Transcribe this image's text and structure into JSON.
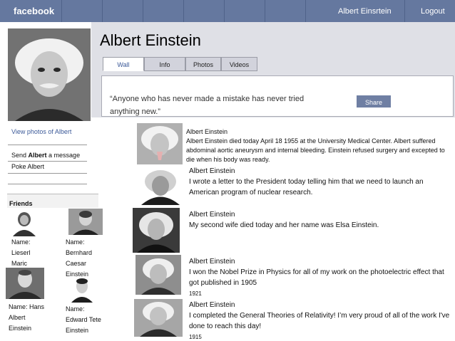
{
  "topbar": {
    "brand": "facebook",
    "user_name": "Albert Einsrtein",
    "logout": "Logout"
  },
  "profile": {
    "name": "Albert Einstein"
  },
  "tabs": [
    {
      "label": "Wall",
      "active": true
    },
    {
      "label": "Info",
      "active": false
    },
    {
      "label": "Photos",
      "active": false
    },
    {
      "label": "Videos",
      "active": false
    }
  ],
  "post": {
    "text": "“Anyone who has never made a mistake has never  tried anything new.”",
    "share_label": "Share"
  },
  "sidebar": {
    "view_photos": "View photos of Albert",
    "send_prefix": "Send ",
    "send_name": "Albert",
    "send_suffix": " a message",
    "poke": "Poke Albert",
    "friends_heading": "Friends"
  },
  "friends": [
    {
      "lines": [
        "Name:",
        "Lieserl",
        "Maric"
      ]
    },
    {
      "lines": [
        "Name:",
        "Bernhard",
        "Caesar",
        "Einstein"
      ]
    },
    {
      "lines": [
        "Name: Hans",
        "Albert",
        "Einstein"
      ]
    },
    {
      "lines": [
        "Name:",
        "Edward Tete",
        "Einstein"
      ]
    }
  ],
  "feed": [
    {
      "author": "Albert Einstein",
      "text": "Albert Einstein died today April 18 1955 at the University Medical Center. Albert suffered abdominal aortic aneurysm and internal bleeding. Einstein refused surgery and excepted to die when his body was ready.",
      "year": ""
    },
    {
      "author": "Albert Einstein",
      "text": "I wrote a letter to the President today telling him that we need to launch an American program of nuclear research.",
      "year": ""
    },
    {
      "author": "Albert Einstein",
      "text": "My second wife died today and her name was Elsa Einstein.",
      "year": ""
    },
    {
      "author": "Albert Einstein",
      "text": "I won the Nobel Prize in Physics for all of my work on the photoelectric effect that got published in 1905",
      "year": "1921"
    },
    {
      "author": "Albert Einstein",
      "text": "I completed the General Theories of Relativity! I’m very proud of all of the work I've done to reach this day!",
      "year": "1915"
    }
  ],
  "colors": {
    "topbar": "#65789f",
    "band": "#dfe0e6",
    "link": "#3b5998",
    "share_button": "#6f7fa3"
  },
  "icons": {
    "profile_photo": "portrait-photo",
    "friend_photos": "portrait-photo",
    "feed_photos": "portrait-photo"
  }
}
